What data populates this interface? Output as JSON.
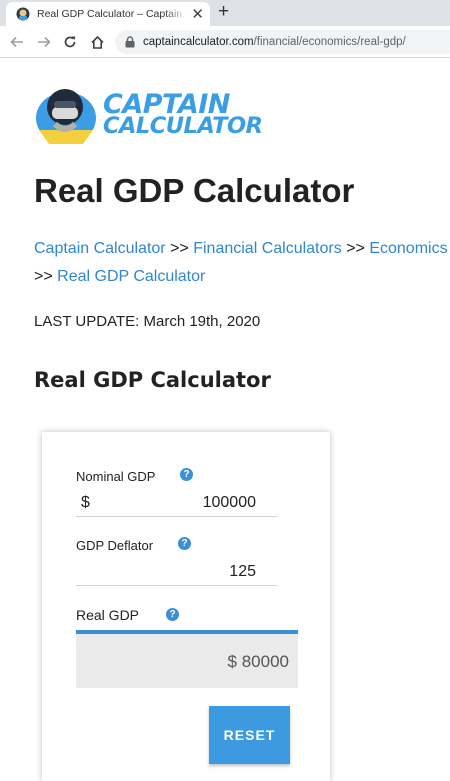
{
  "browser": {
    "tab_title": "Real GDP Calculator – Captain Calculator",
    "close_glyph": "✕",
    "new_tab_glyph": "+",
    "url_host": "captaincalculator.com",
    "url_path": "/financial/economics/real-gdp/"
  },
  "logo": {
    "line1": "CAPTAIN",
    "line2": "CALCULATOR",
    "color": "#3b9ee4"
  },
  "page": {
    "title": "Real GDP Calculator",
    "breadcrumb": {
      "item1": "Captain Calculator",
      "sep": ">>",
      "item2": "Financial Calculators",
      "item3": "Economics Calculators",
      "item4": "Real GDP Calculator"
    },
    "last_update_label": "Last Update:",
    "last_update_date": "March 19th, 2020",
    "section_title": "Real GDP Calculator"
  },
  "calculator": {
    "nominal_gdp": {
      "label": "Nominal GDP",
      "prefix": "$",
      "value": "100000"
    },
    "gdp_deflator": {
      "label": "GDP Deflator",
      "value": "125"
    },
    "real_gdp": {
      "label": "Real GDP",
      "value": "$ 80000"
    },
    "help_glyph": "?",
    "reset_label": "RESET",
    "accent_color": "#3b8fd9"
  }
}
